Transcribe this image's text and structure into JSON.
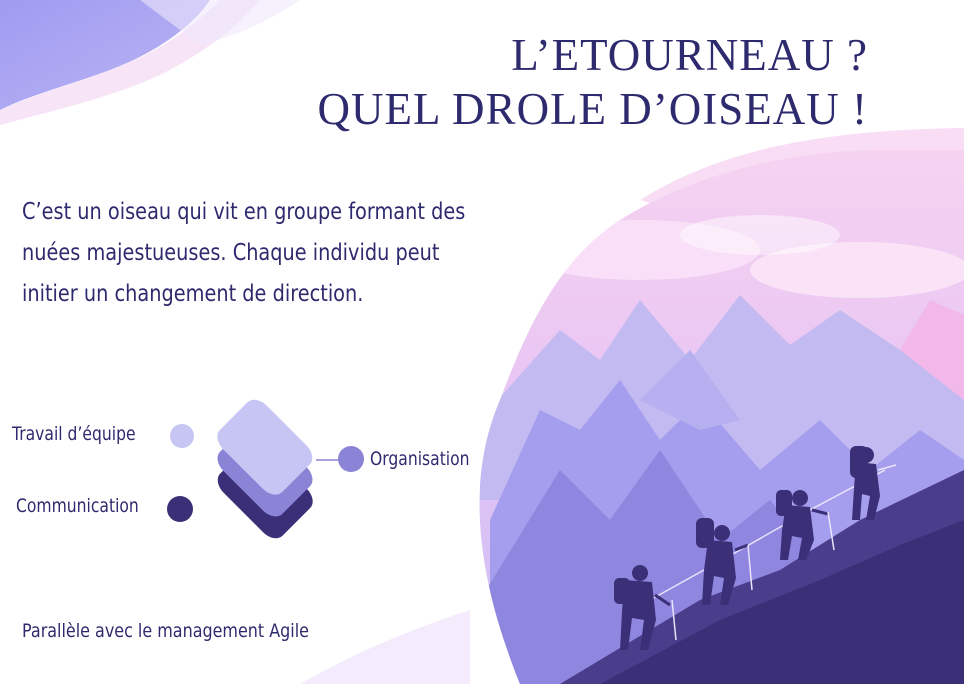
{
  "title": {
    "line1": "L’ETOURNEAU ?",
    "line2": "QUEL DROLE D’OISEAU !"
  },
  "intro": {
    "line1": "C’est un oiseau qui vit en groupe formant des",
    "line2": "nuées majestueuses. Chaque individu peut",
    "line3": "initier un changement de direction."
  },
  "diagram": {
    "items": [
      {
        "label": "Travail d’équipe",
        "color": "#c7c5f3"
      },
      {
        "label": "Organisation",
        "color": "#8b83d6"
      },
      {
        "label": "Communication",
        "color": "#3b2f77"
      }
    ]
  },
  "footer": {
    "text": "Parallèle avec le management Agile"
  },
  "colors": {
    "text": "#2e2a6e",
    "lavender": "#a7a1ef",
    "pink": "#f3c3ef",
    "deep_purple": "#3b2f77"
  },
  "icons": [
    "layer-stack-icon",
    "hikers-illustration",
    "mountains-illustration"
  ]
}
